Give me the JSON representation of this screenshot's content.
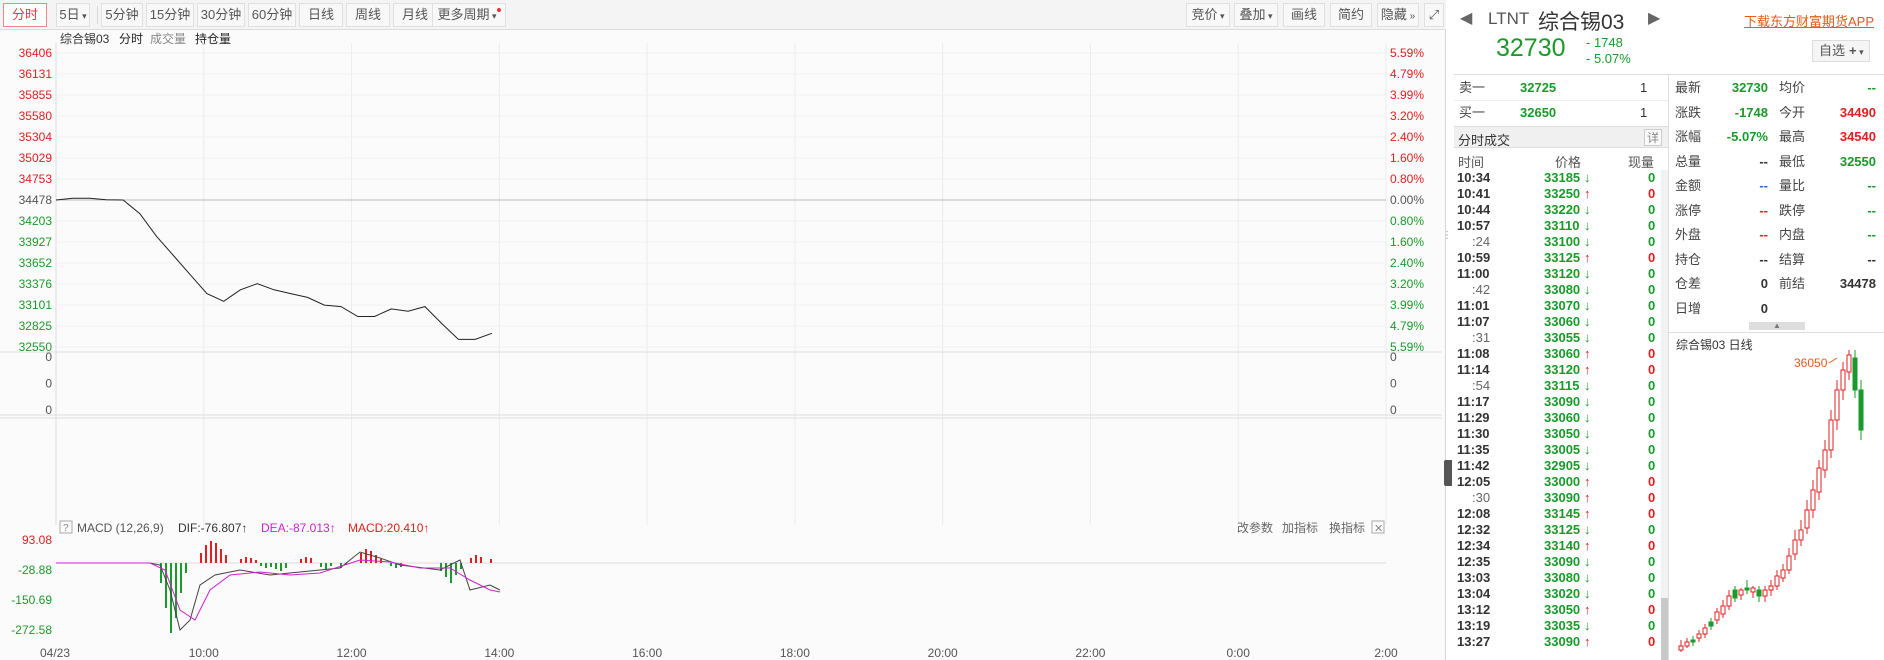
{
  "toolbar": {
    "periods": [
      "分时",
      "5日",
      "5分钟",
      "15分钟",
      "30分钟",
      "60分钟",
      "日线",
      "周线",
      "月线",
      "更多周期"
    ],
    "right_tools": [
      "竞价",
      "叠加",
      "画线",
      "简约",
      "隐藏"
    ]
  },
  "chart": {
    "symbol": "综合锡03",
    "sub_tabs": [
      "分时",
      "成交量",
      "持仓量"
    ],
    "price_ticks": [
      "36406",
      "36131",
      "35855",
      "35580",
      "35304",
      "35029",
      "34753",
      "34478",
      "34203",
      "33927",
      "33652",
      "33376",
      "33101",
      "32825",
      "32550"
    ],
    "pct_ticks": [
      "5.59%",
      "4.79%",
      "3.99%",
      "3.20%",
      "2.40%",
      "1.60%",
      "0.80%",
      "0.00%",
      "0.80%",
      "1.60%",
      "2.40%",
      "3.20%",
      "3.99%",
      "4.79%",
      "5.59%"
    ],
    "volume_ticks": [
      "0",
      "0",
      "0"
    ],
    "macd_header": {
      "help": "?",
      "name": "MACD (12,26,9)",
      "dif": "DIF:-76.807↑",
      "dea": "DEA:-87.013↑",
      "macd": "MACD:20.410↑"
    },
    "macd_tools": [
      "改参数",
      "加指标",
      "换指标"
    ],
    "macd_ticks": [
      "93.08",
      "-28.88",
      "-150.69",
      "-272.58"
    ],
    "time_labels": [
      "04/23",
      "10:00",
      "12:00",
      "14:00",
      "16:00",
      "18:00",
      "20:00",
      "22:00",
      "0:00",
      "2:00"
    ],
    "colors": {
      "up": "#e02020",
      "down": "#1a9a2a",
      "dif": "#444444",
      "dea": "#d020d0"
    }
  },
  "chart_data": {
    "type": "line",
    "title": "",
    "series": [
      {
        "values": [
          34478,
          34500,
          34500,
          34480,
          34478,
          34300,
          34000,
          33750,
          33500,
          33250,
          33150,
          33300,
          33380,
          33300,
          33250,
          33200,
          33100,
          33080,
          32950,
          32950,
          33050,
          33020,
          33080,
          32860,
          32650,
          32650,
          32730
        ]
      }
    ],
    "ylim": [
      32550,
      36406
    ]
  },
  "header": {
    "market": "LTNT",
    "name": "综合锡03",
    "download_link": "下载东方财富期货APP",
    "price": "32730",
    "change": "- 1748",
    "change_pct": "- 5.07%",
    "watch_button": "自选",
    "watch_plus": "+"
  },
  "orderbook": [
    {
      "label": "卖一",
      "price": "32725",
      "qty": "1"
    },
    {
      "label": "买一",
      "price": "32650",
      "qty": "1"
    }
  ],
  "stats": [
    {
      "l1": "最新",
      "v1": "32730",
      "c1": "green",
      "l2": "均价",
      "v2": "--",
      "c2": "green"
    },
    {
      "l1": "涨跌",
      "v1": "-1748",
      "c1": "green",
      "l2": "今开",
      "v2": "34490",
      "c2": "red"
    },
    {
      "l1": "涨幅",
      "v1": "-5.07%",
      "c1": "green",
      "l2": "最高",
      "v2": "34540",
      "c2": "red"
    },
    {
      "l1": "总量",
      "v1": "--",
      "c1": "gray",
      "l2": "最低",
      "v2": "32550",
      "c2": "green"
    },
    {
      "l1": "金额",
      "v1": "--",
      "c1": "blue",
      "l2": "量比",
      "v2": "--",
      "c2": "green"
    },
    {
      "l1": "涨停",
      "v1": "--",
      "c1": "red",
      "l2": "跌停",
      "v2": "--",
      "c2": "green"
    },
    {
      "l1": "外盘",
      "v1": "--",
      "c1": "red",
      "l2": "内盘",
      "v2": "--",
      "c2": "green"
    },
    {
      "l1": "持仓",
      "v1": "--",
      "c1": "gray",
      "l2": "结算",
      "v2": "--",
      "c2": "gray"
    },
    {
      "l1": "仓差",
      "v1": "0",
      "c1": "gray",
      "l2": "前结",
      "v2": "34478",
      "c2": "gray"
    },
    {
      "l1": "日增",
      "v1": "0",
      "c1": "gray",
      "l2": "",
      "v2": "",
      "c2": "gray"
    }
  ],
  "trades": {
    "title": "分时成交",
    "detail_button": "详",
    "headers": [
      "时间",
      "价格",
      "现量"
    ],
    "rows": [
      {
        "time": "10:34",
        "price": "33185",
        "dir": "down",
        "qty": "0"
      },
      {
        "time": "10:41",
        "price": "33250",
        "dir": "up",
        "qty": "0"
      },
      {
        "time": "10:44",
        "price": "33220",
        "dir": "down",
        "qty": "0"
      },
      {
        "time": "10:57",
        "price": "33110",
        "dir": "down",
        "qty": "0"
      },
      {
        "time": ":24",
        "price": "33100",
        "dir": "down",
        "qty": "0"
      },
      {
        "time": "10:59",
        "price": "33125",
        "dir": "up",
        "qty": "0"
      },
      {
        "time": "11:00",
        "price": "33120",
        "dir": "down",
        "qty": "0"
      },
      {
        "time": ":42",
        "price": "33080",
        "dir": "down",
        "qty": "0"
      },
      {
        "time": "11:01",
        "price": "33070",
        "dir": "down",
        "qty": "0"
      },
      {
        "time": "11:07",
        "price": "33060",
        "dir": "down",
        "qty": "0"
      },
      {
        "time": ":31",
        "price": "33055",
        "dir": "down",
        "qty": "0"
      },
      {
        "time": "11:08",
        "price": "33060",
        "dir": "up",
        "qty": "0"
      },
      {
        "time": "11:14",
        "price": "33120",
        "dir": "up",
        "qty": "0"
      },
      {
        "time": ":54",
        "price": "33115",
        "dir": "down",
        "qty": "0"
      },
      {
        "time": "11:17",
        "price": "33090",
        "dir": "down",
        "qty": "0"
      },
      {
        "time": "11:29",
        "price": "33060",
        "dir": "down",
        "qty": "0"
      },
      {
        "time": "11:30",
        "price": "33050",
        "dir": "down",
        "qty": "0"
      },
      {
        "time": "11:35",
        "price": "33005",
        "dir": "down",
        "qty": "0"
      },
      {
        "time": "11:42",
        "price": "32905",
        "dir": "down",
        "qty": "0"
      },
      {
        "time": "12:05",
        "price": "33000",
        "dir": "up",
        "qty": "0"
      },
      {
        "time": ":30",
        "price": "33090",
        "dir": "up",
        "qty": "0"
      },
      {
        "time": "12:08",
        "price": "33145",
        "dir": "up",
        "qty": "0"
      },
      {
        "time": "12:32",
        "price": "33125",
        "dir": "down",
        "qty": "0"
      },
      {
        "time": "12:34",
        "price": "33140",
        "dir": "up",
        "qty": "0"
      },
      {
        "time": "12:35",
        "price": "33090",
        "dir": "down",
        "qty": "0"
      },
      {
        "time": "13:03",
        "price": "33080",
        "dir": "down",
        "qty": "0"
      },
      {
        "time": "13:04",
        "price": "33020",
        "dir": "down",
        "qty": "0"
      },
      {
        "time": "13:12",
        "price": "33050",
        "dir": "up",
        "qty": "0"
      },
      {
        "time": "13:19",
        "price": "33035",
        "dir": "down",
        "qty": "0"
      },
      {
        "time": "13:27",
        "price": "33090",
        "dir": "up",
        "qty": "0"
      }
    ]
  },
  "daily": {
    "title": "综合锡03 日线",
    "high_label": "36050"
  }
}
